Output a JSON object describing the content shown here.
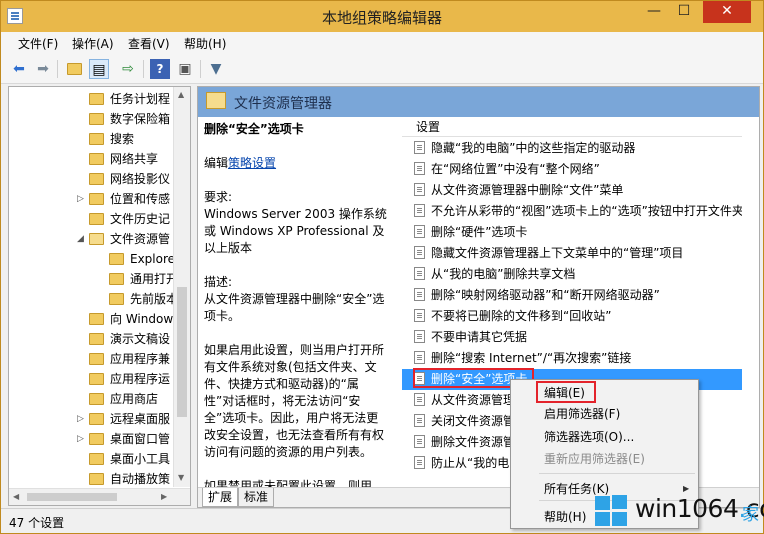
{
  "window": {
    "title": "本地组策略编辑器",
    "controls": {
      "minimize": "—",
      "maximize": "☐",
      "close": "✕"
    }
  },
  "menu": [
    "文件(F)",
    "操作(A)",
    "查看(V)",
    "帮助(H)"
  ],
  "toolbar": {
    "icons": [
      "back-arrow-icon",
      "forward-arrow-icon",
      "up-folder-icon",
      "show-hide-tree-icon",
      "export-list-icon",
      "help-icon",
      "properties-icon",
      "filter-icon"
    ]
  },
  "tree": {
    "items": [
      {
        "label": "任务计划程",
        "level": 1
      },
      {
        "label": "数字保险箱",
        "level": 1
      },
      {
        "label": "搜索",
        "level": 1
      },
      {
        "label": "网络共享",
        "level": 1
      },
      {
        "label": "网络投影仪",
        "level": 1
      },
      {
        "label": "位置和传感",
        "level": 1,
        "expander": "▷"
      },
      {
        "label": "文件历史记",
        "level": 1
      },
      {
        "label": "文件资源管",
        "level": 1,
        "expander": "◢",
        "open": true
      },
      {
        "label": "Explore",
        "level": 2
      },
      {
        "label": "通用打开",
        "level": 2
      },
      {
        "label": "先前版本",
        "level": 2
      },
      {
        "label": "向 Window",
        "level": 1
      },
      {
        "label": "演示文稿设",
        "level": 1
      },
      {
        "label": "应用程序兼",
        "level": 1
      },
      {
        "label": "应用程序运",
        "level": 1
      },
      {
        "label": "应用商店",
        "level": 1
      },
      {
        "label": "远程桌面服",
        "level": 1,
        "expander": "▷"
      },
      {
        "label": "桌面窗口管",
        "level": 1,
        "expander": "▷"
      },
      {
        "label": "桌面小工具",
        "level": 1
      },
      {
        "label": "自动播放策",
        "level": 1
      }
    ]
  },
  "right": {
    "header": "文件资源管理器",
    "description": {
      "title": "删除“安全”选项卡",
      "edit_prefix": "编辑",
      "edit_link": "策略设置",
      "requirements_label": "要求:",
      "requirements_text": "Windows Server 2003 操作系统或 Windows XP Professional 及以上版本",
      "desc_label": "描述:",
      "desc_text": "从文件资源管理器中删除“安全”选项卡。",
      "body_text": "如果启用此设置，则当用户打开所有文件系统对象(包括文件夹、文件、快捷方式和驱动器)的“属性”对话框时，将无法访问“安全”选项卡。因此，用户将无法更改安全设置，也无法查看所有有权访问有问题的资源的用户列表。",
      "cut_text": "如果禁用或未配置此设置，则用"
    },
    "column_header": "设置",
    "settings": [
      "隐藏“我的电脑”中的这些指定的驱动器",
      "在“网络位置”中没有“整个网络”",
      "从文件资源管理器中删除“文件”菜单",
      "不允许从彩带的“视图”选项卡上的“选项”按钮中打开文件夹",
      "删除“硬件”选项卡",
      "隐藏文件资源管理器上下文菜单中的“管理”项目",
      "从“我的电脑”删除共享文档",
      "删除“映射网络驱动器”和“断开网络驱动器”",
      "不要将已删除的文件移到“回收站”",
      "不要申请其它凭据",
      "删除“搜索 Internet”/“再次搜索”链接",
      "删除“安全”选项卡",
      "从文件资源管理",
      "关闭文件资源管",
      "删除文件资源管",
      "防止从“我的电"
    ],
    "selected_index": 11,
    "tabs": [
      "扩展",
      "标准"
    ]
  },
  "context_menu": {
    "items": [
      {
        "label": "编辑(E)",
        "enabled": true
      },
      {
        "label": "启用筛选器(F)",
        "enabled": true
      },
      {
        "label": "筛选器选项(O)...",
        "enabled": true
      },
      {
        "label": "重新应用筛选器(E)",
        "enabled": false
      },
      {
        "label": "所有任务(K)",
        "enabled": true,
        "submenu": true
      },
      {
        "label": "帮助(H)",
        "enabled": true
      }
    ]
  },
  "status": "47 个设置",
  "watermark": {
    "text_a": "win1064",
    "dot": ".",
    "text_b": "com",
    "suffix": "家"
  },
  "colors": {
    "titlebar": "#e9b84a",
    "header": "#7aa6d8",
    "selection": "#3399ff",
    "highlight": "#e3232b",
    "watermark": "#2ea3e6"
  }
}
